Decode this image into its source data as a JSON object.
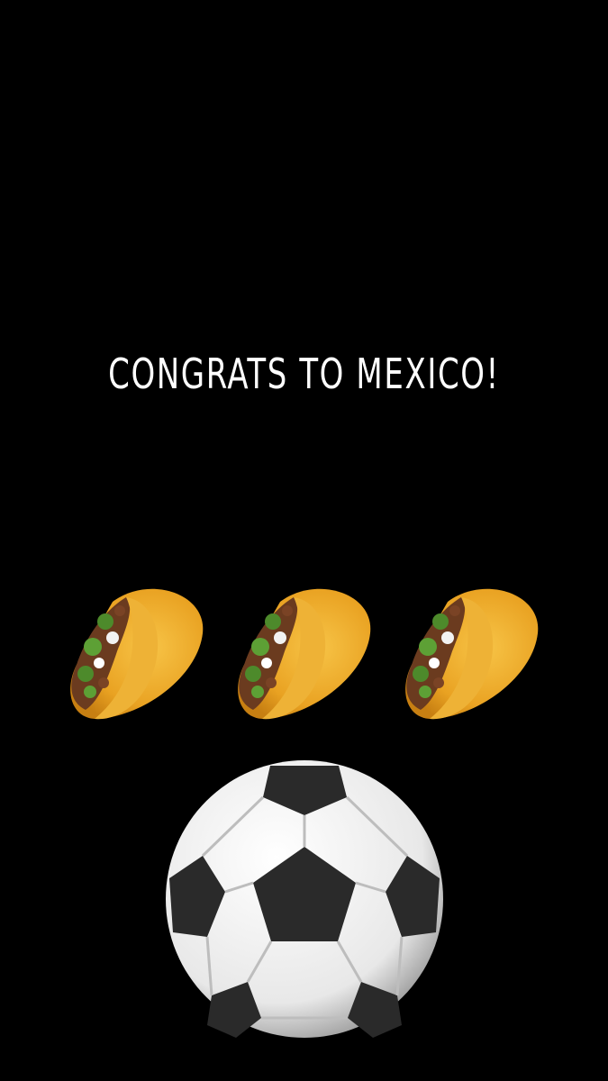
{
  "story": {
    "caption": "CONGRATS TO MEXICO!",
    "caption_color": "#ffffff",
    "background_color": "#000000"
  },
  "stickers": {
    "tacos": [
      "taco-icon",
      "taco-icon",
      "taco-icon"
    ],
    "ball": "soccer-ball-icon"
  }
}
